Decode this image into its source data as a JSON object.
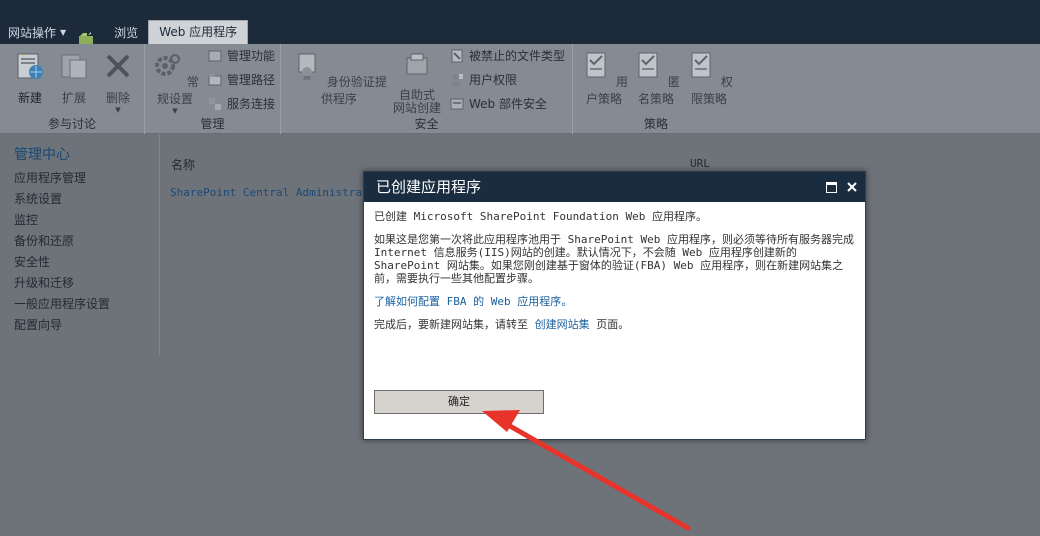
{
  "topbar": {
    "site_actions": "网站操作",
    "tabs": [
      "浏览",
      "Web 应用程序"
    ]
  },
  "ribbon": {
    "groups": {
      "contribute": {
        "label": "参与讨论",
        "new": "新建",
        "extend": "扩展",
        "delete": "删除"
      },
      "manage": {
        "label": "管理",
        "general": "常规设置",
        "features": "管理功能",
        "paths": "管理路径",
        "connections": "服务连接"
      },
      "security": {
        "label": "安全",
        "auth": "身份验证提供程序",
        "selfservice_1": "自助式",
        "selfservice_2": "网站创建",
        "blocked": "被禁止的文件类型",
        "permissions": "用户权限",
        "webpart": "Web 部件安全"
      },
      "policy": {
        "label": "策略",
        "user": "用户策略",
        "anon": "匿名策略",
        "perm": "权限策略"
      }
    }
  },
  "leftnav": {
    "title": "管理中心",
    "items": [
      "应用程序管理",
      "系统设置",
      "监控",
      "备份和还原",
      "安全性",
      "升级和迁移",
      "一般应用程序设置",
      "配置向导"
    ]
  },
  "content": {
    "col_name": "名称",
    "col_url": "URL",
    "row": "SharePoint Central Administration"
  },
  "dialog": {
    "title": "已创建应用程序",
    "line1": "已创建 Microsoft SharePoint Foundation Web 应用程序。",
    "line2": "如果这是您第一次将此应用程序池用于 SharePoint Web 应用程序，则必须等待所有服务器完成 Internet 信息服务(IIS)网站的创建。默认情况下，不会随 Web 应用程序创建新的 SharePoint 网站集。如果您刚创建基于窗体的验证(FBA) Web 应用程序，则在新建网站集之前，需要执行一些其他配置步骤。",
    "learn_link": "了解如何配置 FBA 的 Web 应用程序。",
    "done_prefix": "完成后，要新建网站集，请转至",
    "done_link": "创建网站集",
    "done_suffix": "页面。",
    "ok": "确定"
  },
  "colors": {
    "arrow": "#e8332a",
    "dialog_title_bg": "#1a2c40",
    "link": "#1a5f9e"
  }
}
